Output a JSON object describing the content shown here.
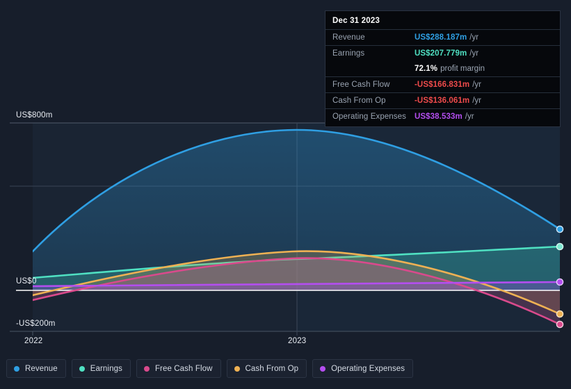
{
  "chart_data": {
    "type": "area",
    "title": "",
    "xlabel": "",
    "ylabel": "",
    "currency": "US$",
    "x": [
      "2022",
      "2023"
    ],
    "x_tick_labels": [
      "2022",
      "2023"
    ],
    "y_tick_labels": [
      "US$800m",
      "US$0",
      "-US$200m"
    ],
    "ylim": [
      -200,
      800
    ],
    "grid": true,
    "legend_position": "bottom",
    "series": [
      {
        "name": "Revenue",
        "color": "#2f9fe3",
        "fill": "#1d4a6e",
        "values": [
          -0.0,
          640,
          720,
          288.187
        ],
        "start_value": 185,
        "peak_value": 722,
        "end_value": 288.187
      },
      {
        "name": "Earnings",
        "color": "#4fe0c2",
        "fill": "#2d6f6d",
        "values": [
          60,
          120,
          145,
          207.779
        ],
        "start_value": 60,
        "end_value": 207.779
      },
      {
        "name": "Free Cash Flow",
        "color": "#d94a8c",
        "fill": "#6b3a52",
        "values": [
          -48,
          110,
          155,
          -166.831
        ],
        "start_value": -48,
        "peak_value": 155,
        "end_value": -166.831
      },
      {
        "name": "Cash From Op",
        "color": "#eeb153",
        "fill": "#6b5a3a",
        "values": [
          -28,
          150,
          188,
          -136.061
        ],
        "start_value": -28,
        "peak_value": 188,
        "end_value": -136.061
      },
      {
        "name": "Operating Expenses",
        "color": "#b44ef0",
        "fill": "#4a3a78",
        "values": [
          20,
          28,
          32,
          38.533
        ],
        "start_value": 20,
        "end_value": 38.533
      }
    ]
  },
  "axis": {
    "y_top": "US$800m",
    "y_zero": "US$0",
    "y_bottom": "-US$200m",
    "x_first": "2022",
    "x_second": "2023"
  },
  "tooltip": {
    "date": "Dec 31 2023",
    "rows": [
      {
        "label": "Revenue",
        "value": "US$288.187m",
        "unit": "/yr",
        "color": "#2f9fe3"
      },
      {
        "label": "Earnings",
        "value": "US$207.779m",
        "unit": "/yr",
        "color": "#4fe0c2"
      },
      {
        "label": "",
        "value": "72.1%",
        "unit": "profit margin",
        "color": "#ffffff"
      },
      {
        "label": "Free Cash Flow",
        "value": "-US$166.831m",
        "unit": "/yr",
        "color": "#ef4b4b"
      },
      {
        "label": "Cash From Op",
        "value": "-US$136.061m",
        "unit": "/yr",
        "color": "#ef4b4b"
      },
      {
        "label": "Operating Expenses",
        "value": "US$38.533m",
        "unit": "/yr",
        "color": "#b44ef0"
      }
    ]
  },
  "legend": {
    "items": [
      {
        "label": "Revenue",
        "color": "#2f9fe3"
      },
      {
        "label": "Earnings",
        "color": "#4fe0c2"
      },
      {
        "label": "Free Cash Flow",
        "color": "#d94a8c"
      },
      {
        "label": "Cash From Op",
        "color": "#eeb153"
      },
      {
        "label": "Operating Expenses",
        "color": "#b44ef0"
      }
    ]
  }
}
